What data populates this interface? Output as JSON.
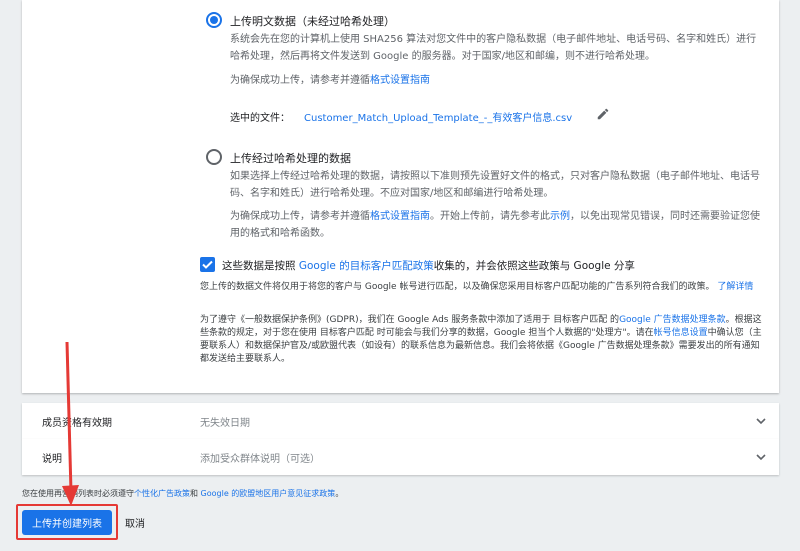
{
  "option_plain": {
    "title": "上传明文数据（未经过哈希处理）",
    "description": "系统会先在您的计算机上使用 SHA256 算法对您文件中的客户隐私数据（电子邮件地址、电话号码、名字和姓氏）进行哈希处理，然后再将文件发送到 Google 的服务器。对于国家/地区和邮编，则不进行哈希处理。",
    "hint_prefix": "为确保成功上传，请参考并遵循",
    "hint_link": "格式设置指南",
    "selected_file_label": "选中的文件：",
    "selected_file_name": "Customer_Match_Upload_Template_-_有效客户信息.csv"
  },
  "option_hashed": {
    "title": "上传经过哈希处理的数据",
    "description": "如果选择上传经过哈希处理的数据，请按照以下准则预先设置好文件的格式，只对客户隐私数据（电子邮件地址、电话号码、名字和姓氏）进行哈希处理。不应对国家/地区和邮编进行哈希处理。",
    "hint_prefix": "为确保成功上传，请参考并遵循",
    "hint_link": "格式设置指南",
    "hint_middle": "。开始上传前，请先参考此",
    "hint_link2": "示例",
    "hint_suffix": "，以免出现常见错误，同时还需要验证您使用的格式和哈希函数。"
  },
  "consent": {
    "prefix": "这些数据是按照 ",
    "link": "Google 的目标客户匹配政策",
    "suffix": "收集的，并会依照这些政策与 Google 分享"
  },
  "policy_note": {
    "text": "您上传的数据文件将仅用于将您的客户与 Google 帐号进行匹配，以及确保您采用目标客户匹配功能的广告系列符合我们的政策。",
    "link": "了解详情"
  },
  "gdpr": {
    "p1": "为了遵守《一般数据保护条例》(GDPR)，我们在 Google Ads 服务条款中添加了适用于 目标客户匹配 的",
    "link1": "Google 广告数据处理条款",
    "p2": "。根据这些条款的规定，对于您在使用 目标客户匹配 时可能会与我们分享的数据，Google 担当个人数据的\"处理方\"。请在",
    "link2": "帐号信息设置",
    "p3": "中确认您（主要联系人）和数据保护官及/或欧盟代表（如设有）的联系信息为最新信息。我们会将依据《Google 广告数据处理条款》需要发出的所有通知都发送给主要联系人。"
  },
  "membership": {
    "label": "成员资格有效期",
    "value": "无失效日期"
  },
  "description_row": {
    "label": "说明",
    "value": "添加受众群体说明（可选）"
  },
  "footer": {
    "prefix": "您在使用再营销列表时必须遵守",
    "link1": "个性化广告政策",
    "mid": "和 ",
    "link2": "Google 的欧盟地区用户意见征求政策",
    "suffix": "。"
  },
  "buttons": {
    "primary": "上传并创建列表",
    "cancel": "取消"
  },
  "colors": {
    "accent": "#1a73e8",
    "annotation": "#e53935"
  }
}
